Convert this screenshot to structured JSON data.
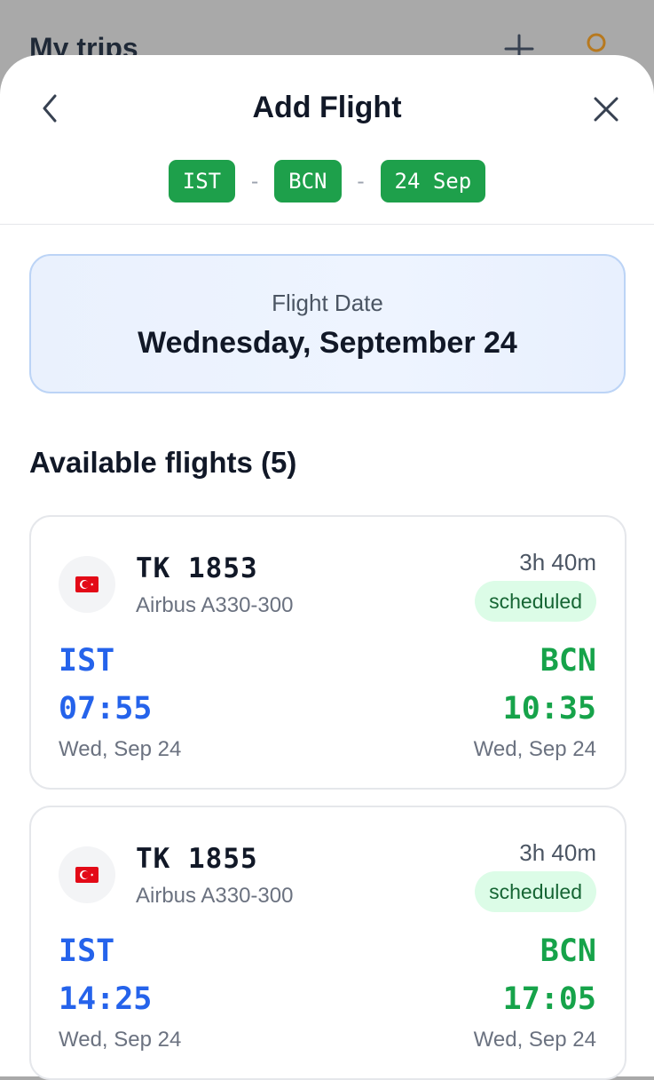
{
  "background": {
    "title": "My trips",
    "plus_icon": "plus-icon",
    "profile_icon": "profile-icon"
  },
  "sheet": {
    "title": "Add Flight",
    "back_icon": "chevron-left-icon",
    "close_icon": "close-icon",
    "chips": {
      "origin": "IST",
      "separator": "-",
      "destination": "BCN",
      "date": "24 Sep"
    }
  },
  "flight_date": {
    "label": "Flight Date",
    "value": "Wednesday, September 24"
  },
  "available": {
    "title": "Available flights (5)"
  },
  "flights": [
    {
      "number": "TK 1853",
      "aircraft": "Airbus A330-300",
      "duration": "3h 40m",
      "status": "scheduled",
      "dep_code": "IST",
      "dep_time": "07:55",
      "dep_day": "Wed, Sep 24",
      "arr_code": "BCN",
      "arr_time": "10:35",
      "arr_day": "Wed, Sep 24"
    },
    {
      "number": "TK 1855",
      "aircraft": "Airbus A330-300",
      "duration": "3h 40m",
      "status": "scheduled",
      "dep_code": "IST",
      "dep_time": "14:25",
      "dep_day": "Wed, Sep 24",
      "arr_code": "BCN",
      "arr_time": "17:05",
      "arr_day": "Wed, Sep 24"
    }
  ],
  "colors": {
    "chip": "#1ea04b",
    "departure": "#2563eb",
    "arrival": "#16a34a",
    "status_bg": "#dcfce7",
    "status_text": "#166534"
  }
}
